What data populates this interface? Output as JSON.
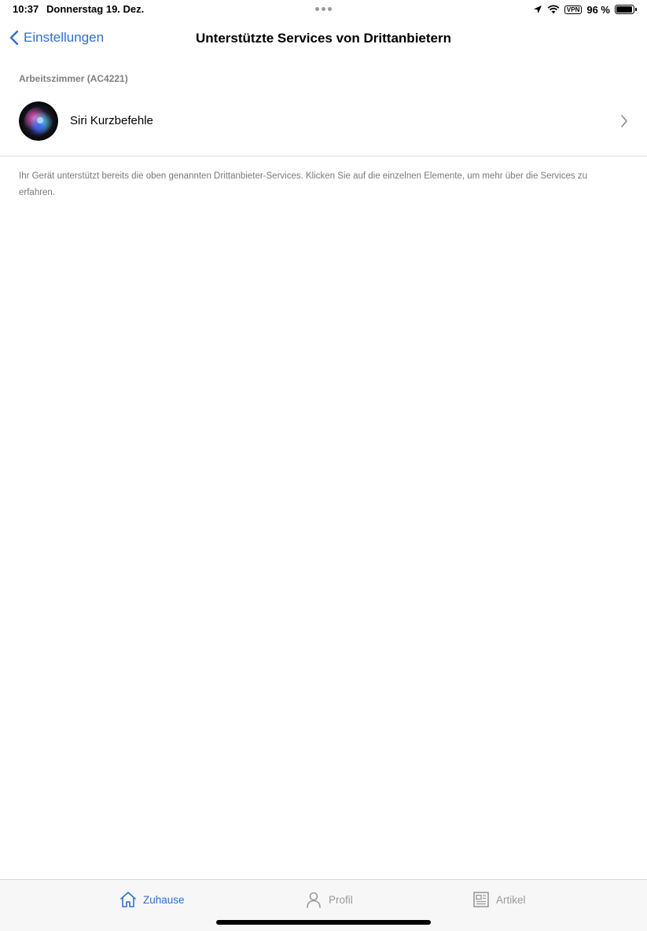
{
  "status_bar": {
    "time": "10:37",
    "date": "Donnerstag 19. Dez.",
    "vpn_label": "VPN",
    "battery_text": "96 %",
    "battery_level": 0.96
  },
  "nav": {
    "back_label": "Einstellungen",
    "title": "Unterstützte Services von Drittanbietern"
  },
  "section": {
    "header": "Arbeitszimmer (AC4221)",
    "items": [
      {
        "label": "Siri Kurzbefehle",
        "icon": "siri-icon"
      }
    ],
    "footnote": "Ihr Gerät unterstützt bereits die oben genannten Drittanbieter-Services. Klicken Sie auf die einzelnen Elemente, um mehr über die Services zu erfahren."
  },
  "tab_bar": {
    "tabs": [
      {
        "label": "Zuhause",
        "icon": "house-icon",
        "active": true
      },
      {
        "label": "Profil",
        "icon": "person-icon",
        "active": false
      },
      {
        "label": "Artikel",
        "icon": "article-icon",
        "active": false
      }
    ]
  },
  "colors": {
    "accent": "#2f6fcf",
    "inactive": "#9a9a9a",
    "secondary_text": "#7a7a7a"
  }
}
